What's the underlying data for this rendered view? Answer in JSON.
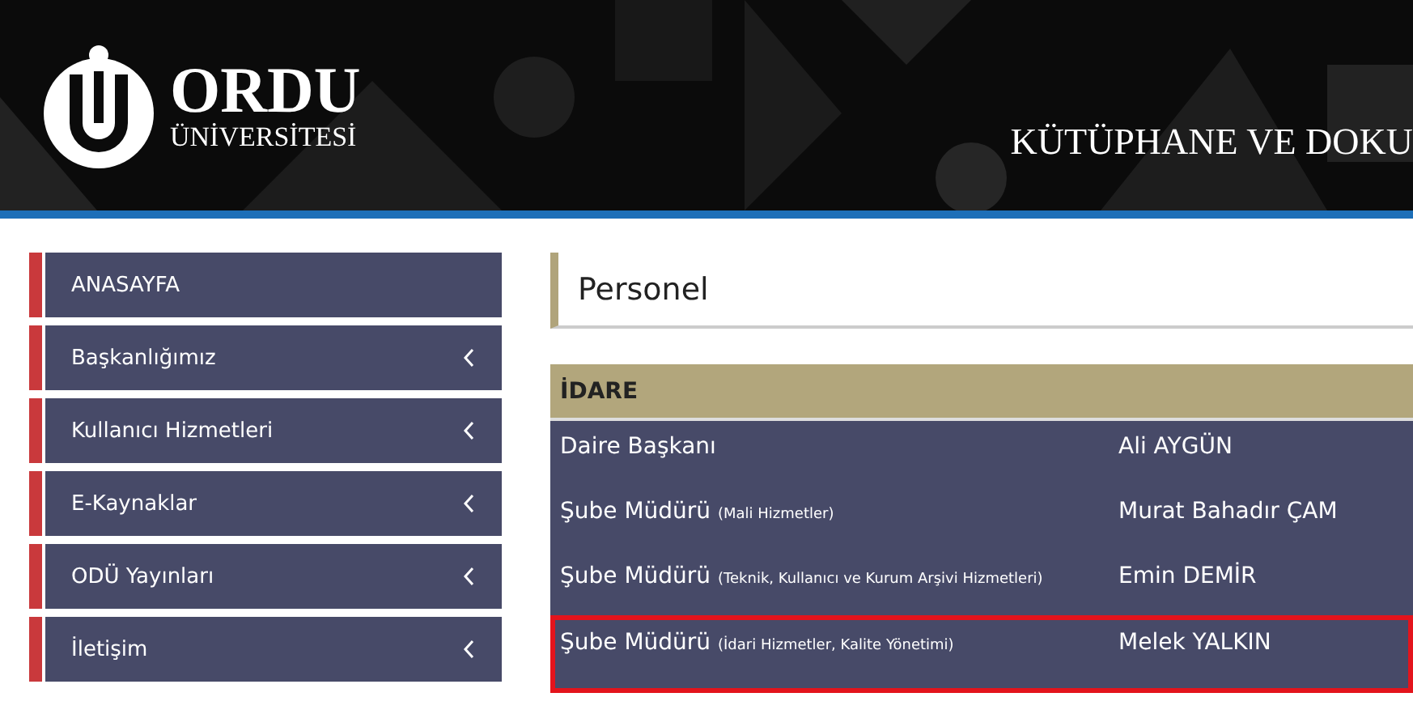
{
  "header": {
    "logo_word": "ORDU",
    "logo_subword": "ÜNİVERSİTESİ",
    "title": "KÜTÜPHANE VE DOKU"
  },
  "sidebar": {
    "items": [
      {
        "label": "ANASAYFA",
        "expandable": false
      },
      {
        "label": "Başkanlığımız",
        "expandable": true
      },
      {
        "label": "Kullanıcı Hizmetleri",
        "expandable": true
      },
      {
        "label": "E-Kaynaklar",
        "expandable": true
      },
      {
        "label": "ODÜ Yayınları",
        "expandable": true
      },
      {
        "label": "İletişim",
        "expandable": true
      }
    ]
  },
  "page_title": "Personel",
  "table": {
    "section": "İDARE",
    "rows": [
      {
        "role": "Daire Başkanı",
        "name": "Ali AYGÜN",
        "highlighted": false
      },
      {
        "role": "Şube Müdürü $_{(Mali Hizmetler)}$",
        "name": "Murat Bahadır ÇAM",
        "highlighted": false
      },
      {
        "role": "Şube Müdürü $_{(Teknik, Kullanıcı ve Kurum Arşivi Hizmetleri)}$",
        "name": "Emin DEMİR",
        "highlighted": false
      },
      {
        "role": "Şube Müdürü $_{(İdari Hizmetler, Kalite Yönetimi)}$",
        "name": "Melek YALKIN",
        "highlighted": true
      }
    ]
  }
}
